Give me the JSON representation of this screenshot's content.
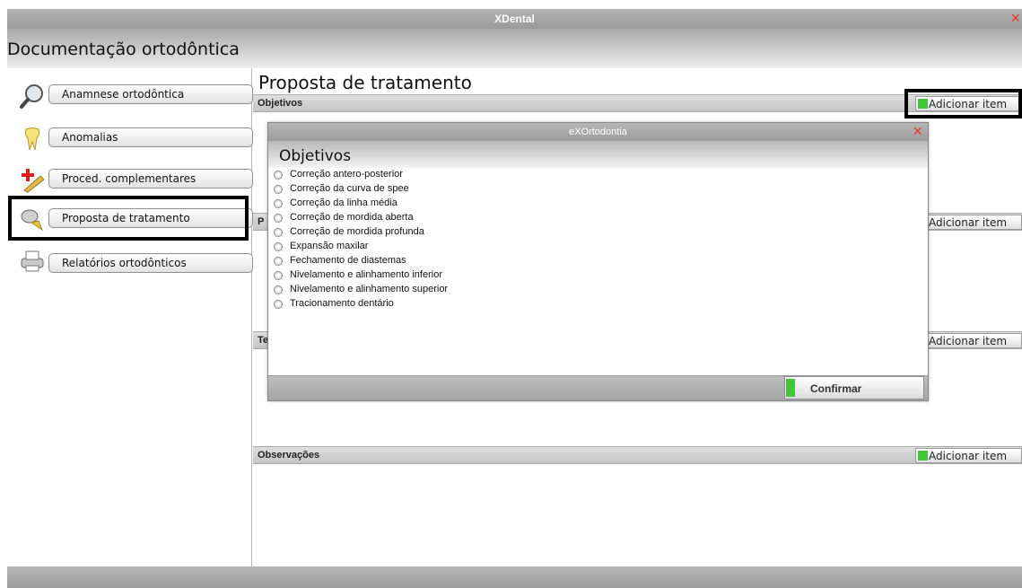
{
  "window": {
    "title": "XDental",
    "close_glyph": "×"
  },
  "header": {
    "title": "Documentação ortodôntica"
  },
  "sidebar": {
    "items": [
      {
        "label": "Anamnese ortodôntica",
        "icon": "magnifier-icon"
      },
      {
        "label": "Anomalias",
        "icon": "tooth-icon"
      },
      {
        "label": "Proced. complementares",
        "icon": "add-procedure-icon"
      },
      {
        "label": "Proposta de tratamento",
        "icon": "brush-icon"
      },
      {
        "label": "Relatórios ortodônticos",
        "icon": "printer-icon"
      }
    ]
  },
  "main": {
    "title": "Proposta de tratamento",
    "sections": [
      {
        "label": "Objetivos",
        "add_label": "Adicionar item"
      },
      {
        "label": "P",
        "add_label": "Adicionar item"
      },
      {
        "label": "Te",
        "add_label": "Adicionar item"
      },
      {
        "label": "Observações",
        "add_label": "Adicionar item"
      }
    ]
  },
  "dialog": {
    "title": "eXOrtodontia",
    "close_glyph": "×",
    "heading": "Objetivos",
    "options": [
      "Correção antero-posterior",
      "Correção da curva de spee",
      "Correção da linha média",
      "Correção de mordida aberta",
      "Correção de mordida profunda",
      "Expansão maxilar",
      "Fechamento de diastemas",
      "Nivelamento e alinhamento inferior",
      "Nivelamento e alinhamento superior",
      "Tracionamento dentário"
    ],
    "confirm_label": "Confirmar"
  },
  "colors": {
    "accent_green": "#43c43b",
    "close_red": "#e8312a",
    "highlight_border": "#000000"
  }
}
